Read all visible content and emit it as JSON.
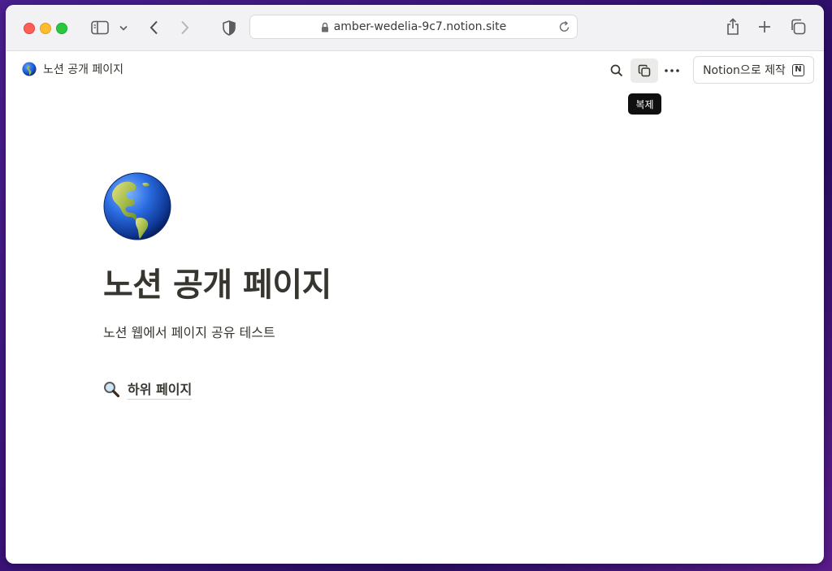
{
  "browser": {
    "url": "amber-wedelia-9c7.notion.site",
    "icons": {
      "sidebar": "sidebar-icon",
      "sidebar_menu": "chevron-down-icon",
      "back": "chevron-left-icon",
      "forward": "chevron-right-icon",
      "privacy": "shield-icon",
      "lock": "lock-icon",
      "reload": "reload-icon",
      "share": "share-icon",
      "new_tab": "plus-icon",
      "tabs": "tab-overview-icon"
    }
  },
  "topbar": {
    "breadcrumb": "노션 공개 페이지",
    "breadcrumb_icon": "globe-americas-emoji",
    "search_icon": "search-icon",
    "duplicate_icon": "duplicate-icon",
    "more_icon": "more-icon",
    "make_button": "Notion으로 제작",
    "make_button_logo": "N",
    "tooltip": "복제"
  },
  "page": {
    "icon": "globe-americas-emoji",
    "title": "노션 공개 페이지",
    "description": "노션 웹에서 페이지 공유 테스트",
    "subpage": {
      "icon": "magnifying-glass-emoji",
      "label": "하위 페이지"
    }
  },
  "colors": {
    "text": "#37352f",
    "toolbar_bg": "#f2f1f4",
    "tooltip_bg": "#0f0f0f",
    "desktop_bg": "#3a1378"
  }
}
